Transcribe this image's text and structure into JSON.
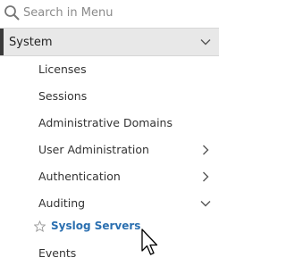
{
  "search": {
    "placeholder": "Search in Menu",
    "value": ""
  },
  "section": {
    "label": "System",
    "expanded": true
  },
  "items": [
    {
      "label": "Licenses"
    },
    {
      "label": "Sessions"
    },
    {
      "label": "Administrative Domains"
    },
    {
      "label": "User Administration",
      "chevron": "chevron-right-icon"
    },
    {
      "label": "Authentication",
      "chevron": "chevron-right-icon"
    },
    {
      "label": "Auditing",
      "chevron": "chevron-down-icon",
      "expanded": true
    },
    {
      "label": "Syslog Servers",
      "active": true,
      "icon": "star-icon"
    },
    {
      "label": "Events"
    }
  ],
  "colors": {
    "accent": "#2a6fb0",
    "section_bg": "#e8e8e8",
    "section_bar": "#3a3a3a"
  },
  "icons": {
    "search": "search-icon",
    "cursor": "mouse-cursor-icon"
  }
}
